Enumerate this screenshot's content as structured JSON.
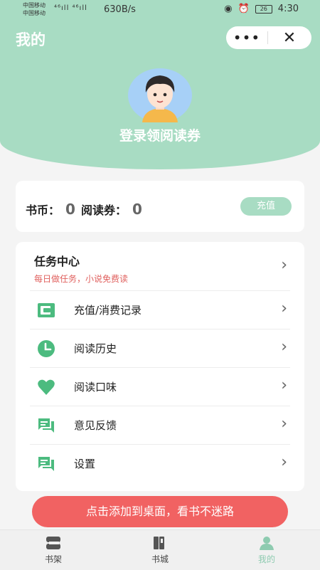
{
  "status_bar": {
    "carrier_top": "中国移动",
    "carrier_bottom": "中国移动",
    "signal": "⁴⁶ıll ⁴⁶ıll",
    "net_speed": "630B/s",
    "battery": "26",
    "time": "4:30"
  },
  "header": {
    "title": "我的",
    "more_label": "•••",
    "close_label": "✕",
    "login_text": "登录领阅读券"
  },
  "account": {
    "coins_label": "书币：",
    "coins_value": "0",
    "vouchers_label": "阅读券：",
    "vouchers_value": "0",
    "recharge_label": "充值"
  },
  "task": {
    "title": "任务中心",
    "subtitle": "每日做任务，小说免费读"
  },
  "menu": [
    {
      "label": "充值/消费记录",
      "icon": "wallet-icon"
    },
    {
      "label": "阅读历史",
      "icon": "clock-icon"
    },
    {
      "label": "阅读口味",
      "icon": "heart-icon"
    },
    {
      "label": "意见反馈",
      "icon": "feedback-icon"
    },
    {
      "label": "设置",
      "icon": "settings-chat-icon"
    }
  ],
  "banner": "点击添加到桌面，看书不迷路",
  "tabs": [
    {
      "label": "书架",
      "icon": "bookshelf-icon"
    },
    {
      "label": "书城",
      "icon": "bookstore-icon"
    },
    {
      "label": "我的",
      "icon": "person-icon"
    }
  ],
  "colors": {
    "accent": "#a8dcc3",
    "icon_green": "#4cbb7f",
    "banner_red": "#f16262",
    "subtitle_red": "#e0605e"
  }
}
